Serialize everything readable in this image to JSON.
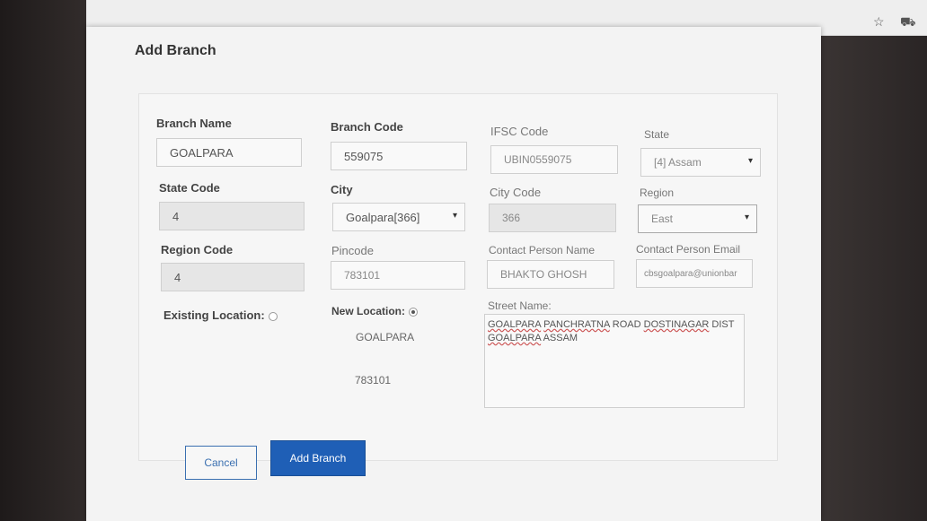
{
  "browser": {
    "bookmark_icon": "star-icon",
    "menu_icon": "cart-icon"
  },
  "modal": {
    "title": "Add Branch",
    "fields": {
      "branch_name": {
        "label": "Branch Name",
        "value": "GOALPARA"
      },
      "branch_code": {
        "label": "Branch Code",
        "value": "559075"
      },
      "ifsc_code": {
        "label": "IFSC Code",
        "value": "UBIN0559075"
      },
      "state": {
        "label": "State",
        "value": "[4] Assam"
      },
      "state_code": {
        "label": "State Code",
        "value": "4"
      },
      "city": {
        "label": "City",
        "value": "Goalpara[366]"
      },
      "city_code": {
        "label": "City Code",
        "value": "366"
      },
      "region": {
        "label": "Region",
        "value": "East"
      },
      "region_code": {
        "label": "Region Code",
        "value": "4"
      },
      "pincode": {
        "label": "Pincode",
        "value": "783101"
      },
      "contact_person_name": {
        "label": "Contact Person Name",
        "value": "BHAKTO GHOSH"
      },
      "contact_person_email": {
        "label": "Contact Person Email",
        "value": "cbsgoalpara@unionbar"
      },
      "existing_location": {
        "label": "Existing Location:"
      },
      "new_location": {
        "label": "New Location:",
        "city": "GOALPARA",
        "pincode": "783101"
      },
      "street_name": {
        "label": "Street Name:",
        "line1_a": "GOALPARA",
        "line1_b": "PANCHRATNA",
        "line1_c": "ROAD",
        "line1_d": "DOSTINAGAR",
        "line1_e": "DIST",
        "line2_a": "GOALPARA",
        "line2_b": "ASSAM"
      }
    },
    "buttons": {
      "cancel": "Cancel",
      "add": "Add Branch"
    }
  },
  "colors": {
    "primary": "#1f5fb6",
    "modal_bg": "#f3f3f3"
  }
}
